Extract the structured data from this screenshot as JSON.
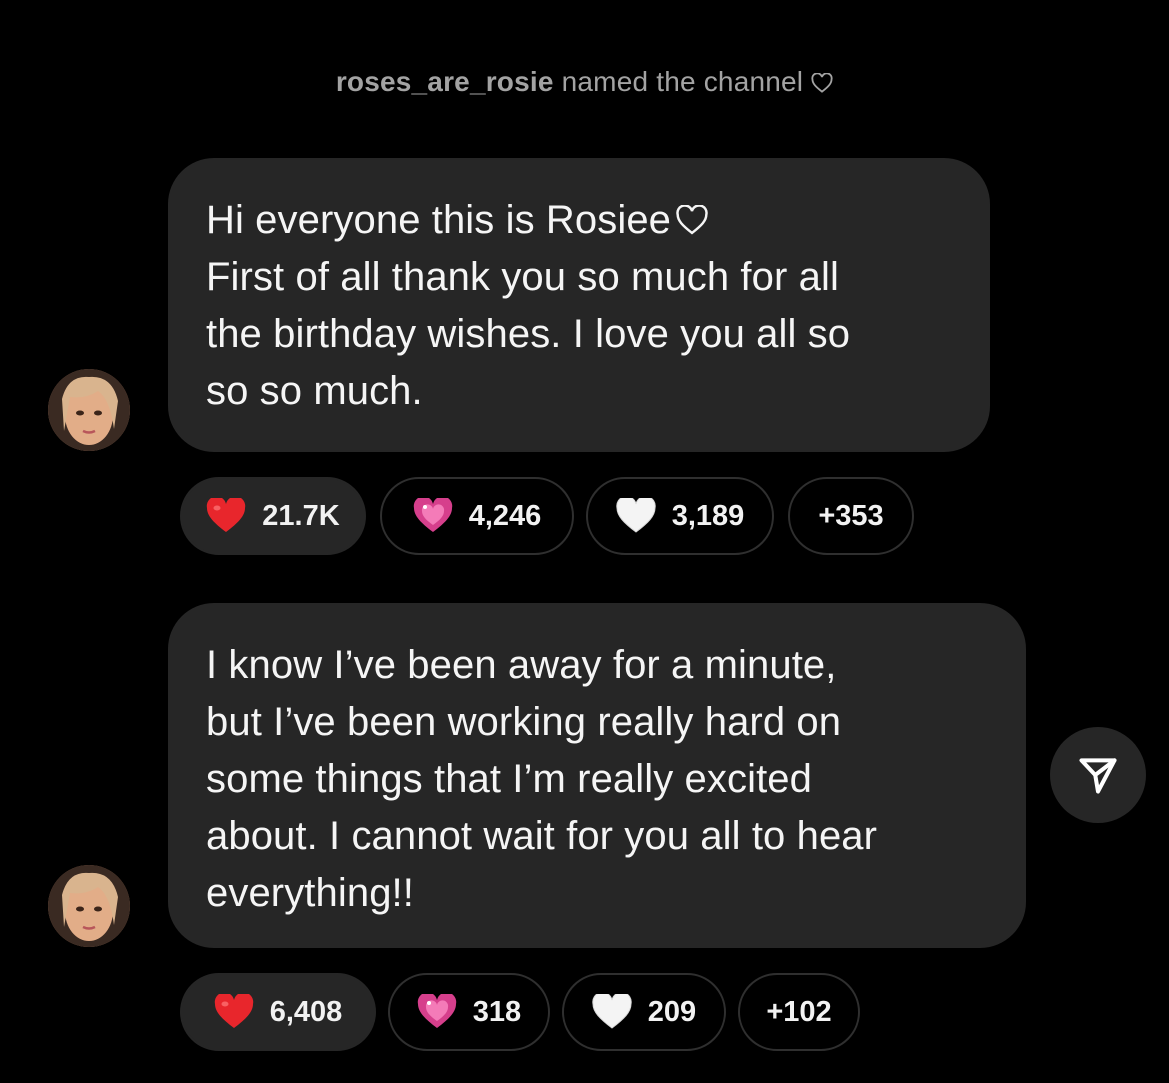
{
  "notice": {
    "username": "roses_are_rosie",
    "text": " named the channel"
  },
  "messages": [
    {
      "lines": [
        "Hi everyone this is Rosiee",
        "First of all thank you so much for all",
        "the birthday wishes. I love you all so",
        "so so much."
      ],
      "reactions": [
        {
          "emoji": "red-heart",
          "count": "21.7K",
          "selected": true
        },
        {
          "emoji": "pink-heart",
          "count": "4,246",
          "selected": false
        },
        {
          "emoji": "white-heart",
          "count": "3,189",
          "selected": false
        },
        {
          "emoji": "more",
          "count": "+353",
          "selected": false
        }
      ]
    },
    {
      "lines": [
        "I know I’ve been away for a minute,",
        "but I’ve been working really hard on",
        "some things that I’m really excited",
        "about. I cannot wait for you all to hear",
        "everything!!"
      ],
      "reactions": [
        {
          "emoji": "red-heart",
          "count": "6,408",
          "selected": true
        },
        {
          "emoji": "pink-heart",
          "count": "318",
          "selected": false
        },
        {
          "emoji": "white-heart",
          "count": "209",
          "selected": false
        },
        {
          "emoji": "more",
          "count": "+102",
          "selected": false
        }
      ]
    }
  ],
  "colors": {
    "background": "#000000",
    "bubble": "#262626",
    "notice_text": "#a3a3a3",
    "red_heart": "#e8262c",
    "pink_heart": "#e0458f"
  }
}
